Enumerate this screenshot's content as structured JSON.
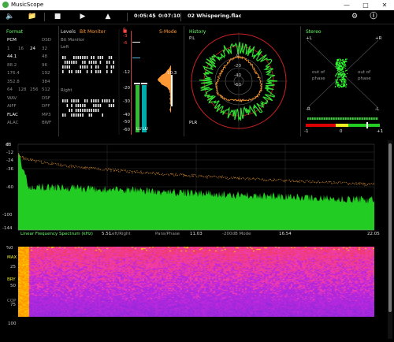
{
  "window": {
    "title": "MusicScope",
    "accent": "#3dbb3d"
  },
  "toolbar": {
    "time_position": "0:05:45",
    "time_separator": "/",
    "time_total": "0:07:10",
    "track": "02 Whispering.flac"
  },
  "format": {
    "label": "Format",
    "rows": [
      [
        "PCM",
        "",
        "",
        "DSD"
      ],
      [
        "1",
        "16",
        "24",
        "32"
      ],
      [
        "44.1",
        "",
        "",
        "48"
      ],
      [
        "88.2",
        "",
        "",
        "96"
      ],
      [
        "176.4",
        "",
        "",
        "192"
      ],
      [
        "352.8",
        "",
        "",
        "384"
      ],
      [
        "64",
        "128",
        "256",
        "512"
      ],
      [
        "WAV",
        "",
        "",
        "DSF"
      ],
      [
        "AIFF",
        "",
        "",
        "DFF"
      ],
      [
        "FLAC",
        "",
        "",
        "MP3"
      ],
      [
        "ALAC",
        "",
        "",
        "BWF"
      ]
    ]
  },
  "levels": {
    "label": "Levels",
    "bitmonitor": "Bit Monitor",
    "left": "Left",
    "right": "Right",
    "meter_scale": [
      "0",
      "-3",
      "-6",
      "-12",
      "-20",
      "-30",
      "-40",
      "-50",
      "-60"
    ],
    "smode": "S-Mode",
    "peak_value": "10.3",
    "lu_labels": [
      "LU",
      "LU"
    ]
  },
  "history": {
    "label": "History",
    "pl": "P.L",
    "plr": "PLR",
    "ring_labels": [
      "0",
      "-20",
      "-40",
      "-60"
    ]
  },
  "stereo": {
    "label": "Stereo",
    "plus_l": "+L",
    "plus_r": "+R",
    "minus_r": "-R",
    "minus_l": "-L",
    "out_phase_left": "out of phase",
    "out_phase_right": "out of phase",
    "corr_minus": "-1",
    "corr_zero": "0",
    "corr_plus": "+1"
  },
  "spectrum": {
    "db_label": "dB",
    "yticks": [
      "0",
      "-12",
      "-24",
      "-36",
      "-60",
      "-100",
      "-144"
    ],
    "footer_label": "Linear Frequency Spectrum (kHz)",
    "xticks": [
      "5.51",
      "11.03",
      "16.54",
      "22.05"
    ],
    "modes": [
      "Left/Right",
      "Pans/Phase",
      "-200dB Mode"
    ]
  },
  "spectrogram": {
    "pct": "%",
    "yticks": [
      "0",
      "25",
      "50",
      "75",
      "100"
    ],
    "side_labels": [
      "MAX",
      "BRY",
      "COP"
    ]
  }
}
